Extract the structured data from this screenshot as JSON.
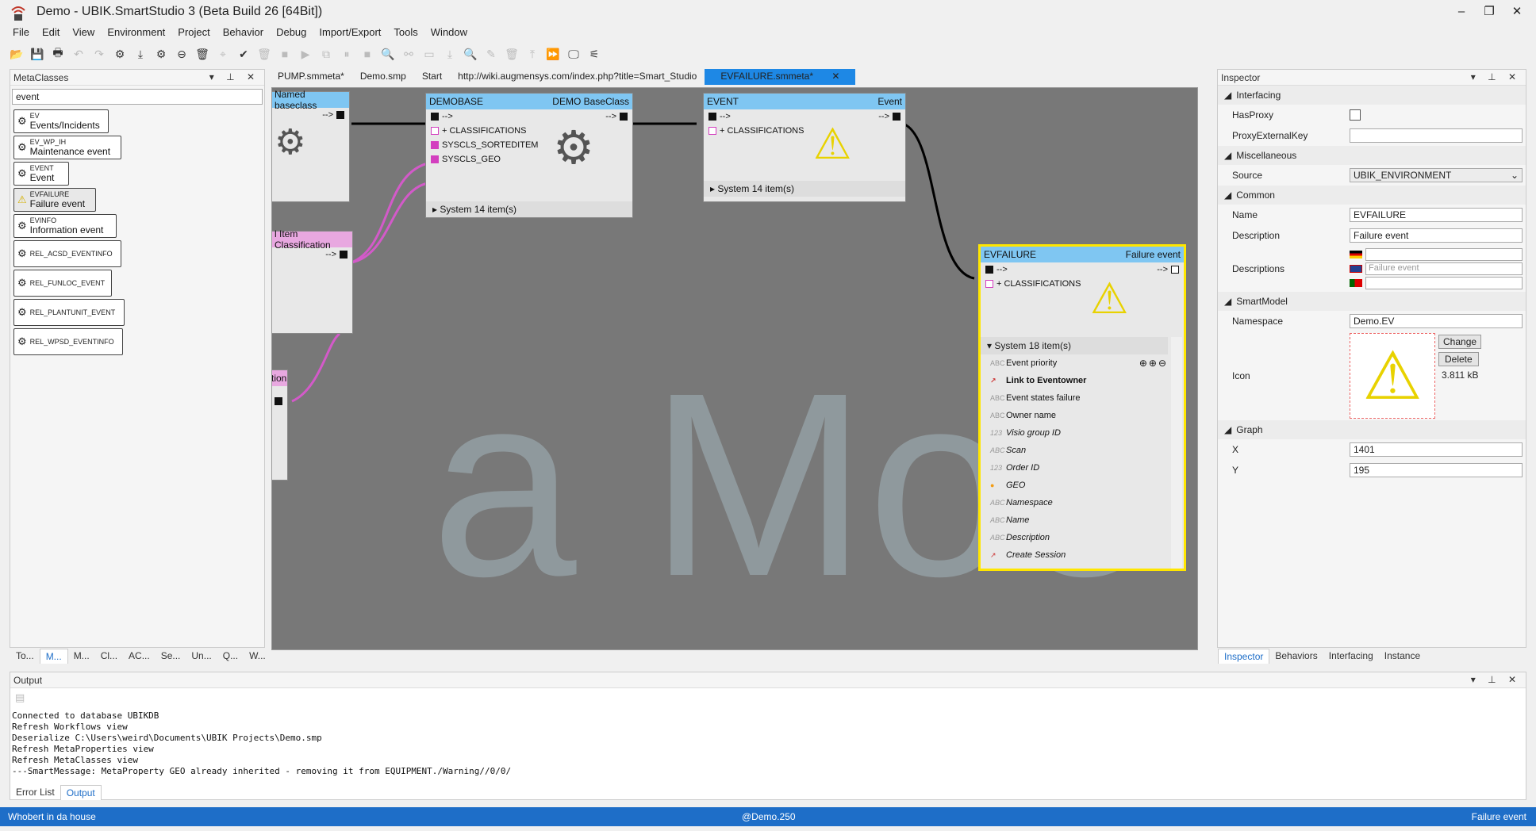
{
  "window": {
    "title": "Demo - UBIK.SmartStudio 3 (Beta Build 26 [64Bit])"
  },
  "menu": [
    "File",
    "Edit",
    "View",
    "Environment",
    "Project",
    "Behavior",
    "Debug",
    "Import/Export",
    "Tools",
    "Window"
  ],
  "metaclasses": {
    "header": "MetaClasses",
    "filter": "event",
    "items": [
      {
        "name": "EV",
        "desc": "Events/Incidents"
      },
      {
        "name": "EV_WP_IH",
        "desc": "Maintenance event"
      },
      {
        "name": "EVENT",
        "desc": "Event"
      },
      {
        "name": "EVFAILURE",
        "desc": "Failure event"
      },
      {
        "name": "EVINFO",
        "desc": "Information event"
      },
      {
        "name": "REL_ACSD_EVENTINFO",
        "desc": ""
      },
      {
        "name": "REL_FUNLOC_EVENT",
        "desc": ""
      },
      {
        "name": "REL_PLANTUNIT_EVENT",
        "desc": ""
      },
      {
        "name": "REL_WPSD_EVENTINFO",
        "desc": ""
      }
    ],
    "tabs": [
      "To...",
      "M...",
      "M...",
      "Cl...",
      "AC...",
      "Se...",
      "Un...",
      "Q...",
      "W..."
    ]
  },
  "doctabs": [
    "PUMP.smmeta*",
    "Demo.smp",
    "Start",
    "http://wiki.augmensys.com/index.php?title=Smart_Studio",
    "EVFAILURE.smmeta*"
  ],
  "canvas": {
    "watermark": "a Moo",
    "named": {
      "title": "Named baseclass",
      "arrow": "-->"
    },
    "classif": {
      "title": "l Item Classification",
      "arrow": "-->"
    },
    "pinktab": "tion",
    "demobase": {
      "title": "DEMOBASE",
      "sub": "DEMO BaseClass",
      "arrow": "-->",
      "rows": [
        "+ CLASSIFICATIONS",
        "SYSCLS_SORTEDITEM",
        "SYSCLS_GEO"
      ],
      "system": "System    14 item(s)"
    },
    "event": {
      "title": "EVENT",
      "sub": "Event",
      "arrow": "-->",
      "rows": [
        "+ CLASSIFICATIONS"
      ],
      "system": "System    14 item(s)"
    },
    "evfailure": {
      "title": "EVFAILURE",
      "sub": "Failure event",
      "arrow": "-->",
      "classif": "+ CLASSIFICATIONS",
      "system": "System    18 item(s)",
      "props": [
        "Event priority",
        "Link to Eventowner",
        "Event states failure",
        "Owner name",
        "Visio group ID",
        "Scan",
        "Order ID",
        "GEO",
        "Namespace",
        "Name",
        "Description",
        "Create Session"
      ]
    }
  },
  "inspector": {
    "header": "Inspector",
    "sections": {
      "interfacing": "Interfacing",
      "misc": "Miscellaneous",
      "common": "Common",
      "smartmodel": "SmartModel",
      "graph": "Graph"
    },
    "hasproxy": "HasProxy",
    "proxyext": "ProxyExternalKey",
    "source_label": "Source",
    "source": "UBIK_ENVIRONMENT",
    "name_label": "Name",
    "name": "EVFAILURE",
    "desc_label": "Description",
    "desc": "Failure event",
    "descs_label": "Descriptions",
    "descs_placeholder": "Failure event",
    "ns_label": "Namespace",
    "ns": "Demo.EV",
    "icon_label": "Icon",
    "change": "Change",
    "delete": "Delete",
    "size": "3.811 kB",
    "x_label": "X",
    "x": "1401",
    "y_label": "Y",
    "y": "195",
    "tabs": [
      "Inspector",
      "Behaviors",
      "Interfacing",
      "Instance"
    ]
  },
  "output": {
    "header": "Output",
    "text": "Connected to database UBIKDB\nRefresh Workflows view\nDeserialize C:\\Users\\weird\\Documents\\UBIK Projects\\Demo.smp\nRefresh MetaProperties view\nRefresh MetaClasses view\n---SmartMessage: MetaProperty GEO already inherited - removing it from EQUIPMENT./Warning//0/0/",
    "tabs": [
      "Error List",
      "Output"
    ]
  },
  "status": {
    "left": "Whobert in da house",
    "center": "@Demo.250",
    "right": "Failure event"
  }
}
